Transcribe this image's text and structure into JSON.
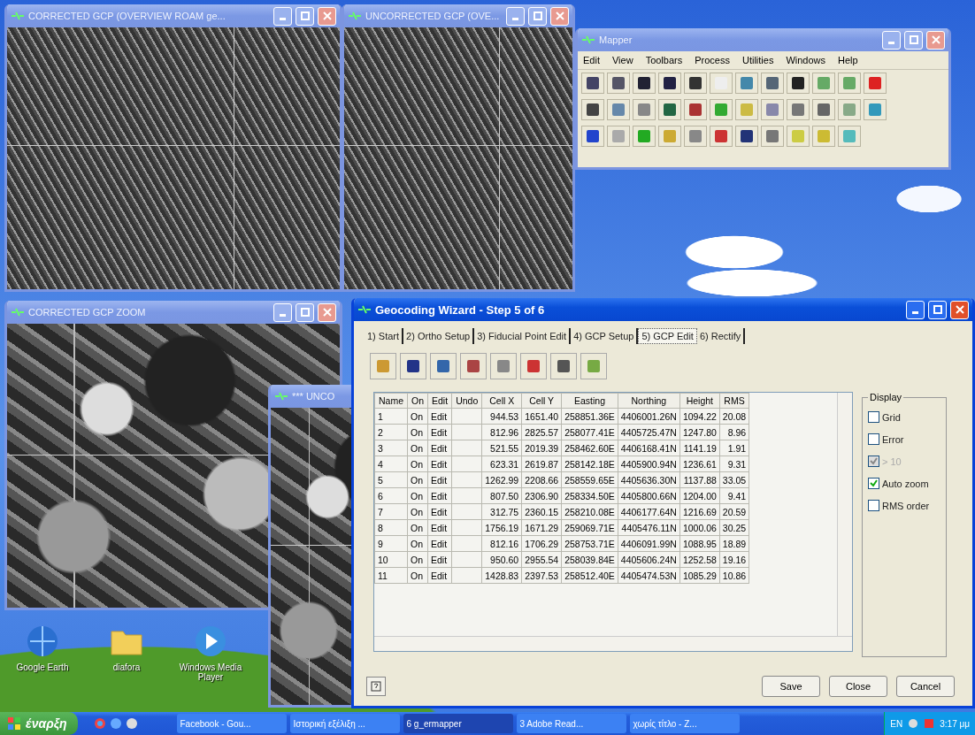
{
  "overview_window": {
    "title": "CORRECTED GCP (OVERVIEW ROAM ge...",
    "active": false
  },
  "uncorrected_window": {
    "title": "UNCORRECTED GCP (OVE...",
    "active": false
  },
  "mapper_window": {
    "title": "Mapper",
    "active": false,
    "menu": [
      "Edit",
      "View",
      "Toolbars",
      "Process",
      "Utilities",
      "Windows",
      "Help"
    ]
  },
  "zoom_window": {
    "title": "CORRECTED GCP ZOOM",
    "active": false
  },
  "unco_window": {
    "title": "*** UNCO",
    "active": false
  },
  "wizard": {
    "title": "Geocoding Wizard - Step 5 of 6",
    "active": true,
    "tabs": [
      {
        "label": "1) Start",
        "selected": false
      },
      {
        "label": "2) Ortho Setup",
        "selected": false
      },
      {
        "label": "3) Fiducial Point Edit",
        "selected": false
      },
      {
        "label": "4) GCP Setup",
        "selected": false
      },
      {
        "label": "5) GCP Edit",
        "selected": true
      },
      {
        "label": "6) Rectify",
        "selected": false
      }
    ],
    "table": {
      "columns": [
        "Name",
        "On",
        "Edit",
        "Undo",
        "Cell X",
        "Cell Y",
        "Easting",
        "Northing",
        "Height",
        "RMS"
      ],
      "rows": [
        [
          "1",
          "On",
          "Edit",
          null,
          "944.53",
          "1651.40",
          "258851.36E",
          "4406001.26N",
          "1094.22",
          "20.08"
        ],
        [
          "2",
          "On",
          "Edit",
          null,
          "812.96",
          "2825.57",
          "258077.41E",
          "4405725.47N",
          "1247.80",
          "8.96"
        ],
        [
          "3",
          "On",
          "Edit",
          null,
          "521.55",
          "2019.39",
          "258462.60E",
          "4406168.41N",
          "1141.19",
          "1.91"
        ],
        [
          "4",
          "On",
          "Edit",
          null,
          "623.31",
          "2619.87",
          "258142.18E",
          "4405900.94N",
          "1236.61",
          "9.31"
        ],
        [
          "5",
          "On",
          "Edit",
          null,
          "1262.99",
          "2208.66",
          "258559.65E",
          "4405636.30N",
          "1137.88",
          "33.05"
        ],
        [
          "6",
          "On",
          "Edit",
          null,
          "807.50",
          "2306.90",
          "258334.50E",
          "4405800.66N",
          "1204.00",
          "9.41"
        ],
        [
          "7",
          "On",
          "Edit",
          null,
          "312.75",
          "2360.15",
          "258210.08E",
          "4406177.64N",
          "1216.69",
          "20.59"
        ],
        [
          "8",
          "On",
          "Edit",
          null,
          "1756.19",
          "1671.29",
          "259069.71E",
          "4405476.11N",
          "1000.06",
          "30.25"
        ],
        [
          "9",
          "On",
          "Edit",
          null,
          "812.16",
          "1706.29",
          "258753.71E",
          "4406091.99N",
          "1088.95",
          "18.89"
        ],
        [
          "10",
          "On",
          "Edit",
          null,
          "950.60",
          "2955.54",
          "258039.84E",
          "4405606.24N",
          "1252.58",
          "19.16"
        ],
        [
          "11",
          "On",
          "Edit",
          null,
          "1428.83",
          "2397.53",
          "258512.40E",
          "4405474.53N",
          "1085.29",
          "10.86"
        ]
      ]
    },
    "display": {
      "title": "Display",
      "options": [
        {
          "label": "Grid",
          "checked": false,
          "disabled": false
        },
        {
          "label": "Error",
          "checked": false,
          "disabled": false
        },
        {
          "label": "> 10",
          "checked": true,
          "disabled": true
        },
        {
          "label": "Auto zoom",
          "checked": true,
          "disabled": false
        },
        {
          "label": "RMS order",
          "checked": false,
          "disabled": false
        }
      ]
    },
    "buttons": [
      "Save",
      "Close",
      "Cancel"
    ]
  },
  "desktop_icons": [
    {
      "kind": "globe",
      "label": "Google Earth"
    },
    {
      "kind": "folder",
      "label": "diafora"
    },
    {
      "kind": "media",
      "label": "Windows Media Player"
    }
  ],
  "taskbar": {
    "start": "έναρξη",
    "tasks": [
      {
        "label": "Facebook - Gou...",
        "selected": false
      },
      {
        "label": "Ιστορική εξέλιξη ...",
        "selected": false
      },
      {
        "label": "6 g_ermapper",
        "selected": true
      },
      {
        "label": "3 Adobe Read...",
        "selected": false
      },
      {
        "label": "χωρίς τίτλο - Ζ...",
        "selected": false
      }
    ],
    "language": "EN",
    "clock": "3:17 μμ"
  }
}
